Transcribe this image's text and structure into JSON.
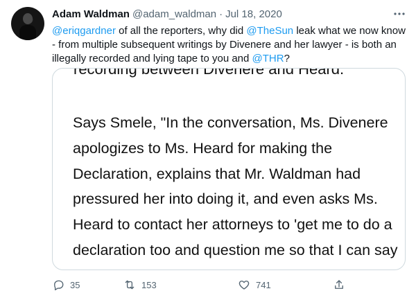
{
  "tweet": {
    "author_name": "Adam Waldman",
    "author_handle": "@adam_waldman",
    "dot": "·",
    "timestamp": "Jul 18, 2020",
    "text": {
      "mention1": "@eriqgardner",
      "part1": " of all the reporters, why did ",
      "mention2": "@TheSun",
      "part2": " leak what we now know - from multiple subsequent writings by Divenere and her lawyer - is both an illegally recorded and lying tape to you and ",
      "mention3": "@THR",
      "part3": "?"
    },
    "media": {
      "cut_line": "recording between Divenere and Heard.",
      "lines": [
        "Says Smele, \"In the conversation, Ms. Divenere",
        "apologizes to Ms. Heard for making the",
        "Declaration, explains that Mr. Waldman had",
        "pressured her into doing it, and even asks Ms.",
        "Heard to contact her attorneys to 'get me to do a",
        "declaration too and question me so that I can say"
      ]
    },
    "actions": {
      "reply_count": "35",
      "retweet_count": "153",
      "like_count": "741"
    }
  },
  "icons": {
    "more": "more-icon",
    "reply": "reply-icon",
    "retweet": "retweet-icon",
    "like": "like-icon",
    "share": "share-icon"
  },
  "colors": {
    "mention": "#1d9bf0",
    "secondary_text": "#536471",
    "card_border": "#cfd9de"
  }
}
